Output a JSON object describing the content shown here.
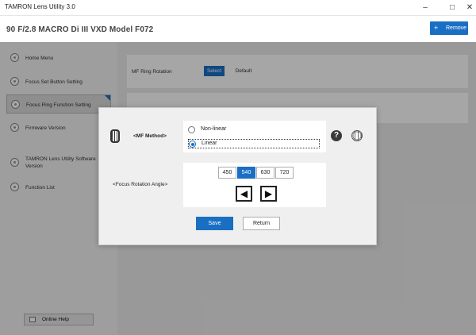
{
  "window": {
    "title": "TAMRON Lens Utility 3.0",
    "minimize": "–",
    "maximize": "□",
    "close": "✕"
  },
  "header": {
    "lens_title": "90 F/2.8 MACRO Di III VXD   Model F072",
    "remove_label": "Remove",
    "remove_icon": "+"
  },
  "sidebar": {
    "items": [
      {
        "label": "Home Menu",
        "icon": "radio-dot-icon"
      },
      {
        "label": "Focus Set Button Setting",
        "icon": "radio-dot-icon"
      },
      {
        "label": "Focus Ring Function Setting",
        "icon": "radio-dot-icon",
        "active": true
      },
      {
        "label": "Firmware Version",
        "icon": "radio-dot-icon"
      },
      {
        "label": "TAMRON Lens Utility Software Version",
        "icon": "radio-dot-icon"
      },
      {
        "label": "Function List",
        "icon": "radio-dot-icon"
      }
    ],
    "help_button": "Online Help"
  },
  "main": {
    "mf_ring_rotation_label": "MF Ring Rotation",
    "select_label": "Select",
    "default_label": "Default"
  },
  "dialog": {
    "mf_method_label": "<MF Method>",
    "options": [
      {
        "label": "Non-linear",
        "selected": false
      },
      {
        "label": "Linear",
        "selected": true
      }
    ],
    "help_icon": "?",
    "focus_rotation_label": "<Focus Rotation Angle>",
    "angles": [
      {
        "label": "450",
        "selected": false
      },
      {
        "label": "540",
        "selected": true
      },
      {
        "label": "630",
        "selected": false
      },
      {
        "label": "720",
        "selected": false
      }
    ],
    "left_arrow": "◀",
    "right_arrow": "▶",
    "save_label": "Save",
    "return_label": "Return"
  },
  "colors": {
    "accent": "#1a6fc3",
    "overlay": "rgba(0,0,0,0.35)"
  }
}
